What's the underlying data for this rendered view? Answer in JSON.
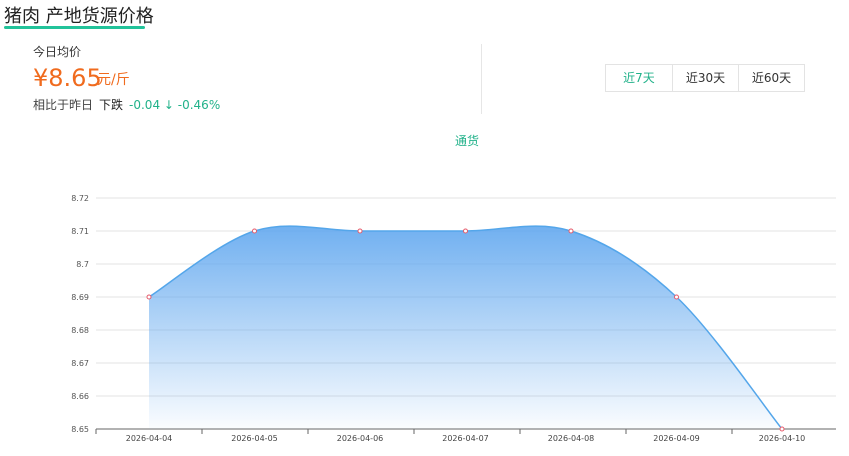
{
  "page": {
    "title": "猪肉 产地货源价格"
  },
  "summary": {
    "label": "今日均价",
    "price_display": "¥8.65",
    "unit": "元/斤",
    "compare_label": "相比于昨日",
    "trend_label": "下跌",
    "trend_value": "-0.04 ↓ -0.46%"
  },
  "range_tabs": [
    {
      "label": "近7天",
      "active": true
    },
    {
      "label": "近30天",
      "active": false
    },
    {
      "label": "近60天",
      "active": false
    }
  ],
  "colors": {
    "accent": "#22b28a",
    "price": "#f06b1e",
    "line": "#54a6ea",
    "fill_top": "#64a9ef",
    "marker": "#e55a6a"
  },
  "chart_data": {
    "type": "area",
    "x": [
      "2026-04-04",
      "2026-04-05",
      "2026-04-06",
      "2026-04-07",
      "2026-04-08",
      "2026-04-09",
      "2026-04-10"
    ],
    "series": [
      {
        "name": "通货",
        "values": [
          8.69,
          8.71,
          8.71,
          8.71,
          8.71,
          8.69,
          8.65
        ]
      }
    ],
    "ylim": [
      8.65,
      8.72
    ],
    "yticks": [
      8.72,
      8.71,
      8.7,
      8.69,
      8.68,
      8.67,
      8.66,
      8.65
    ],
    "ytick_labels": [
      "8.72",
      "8.71",
      "8.7",
      "8.69",
      "8.68",
      "8.67",
      "8.66",
      "8.65"
    ],
    "grid": true
  }
}
